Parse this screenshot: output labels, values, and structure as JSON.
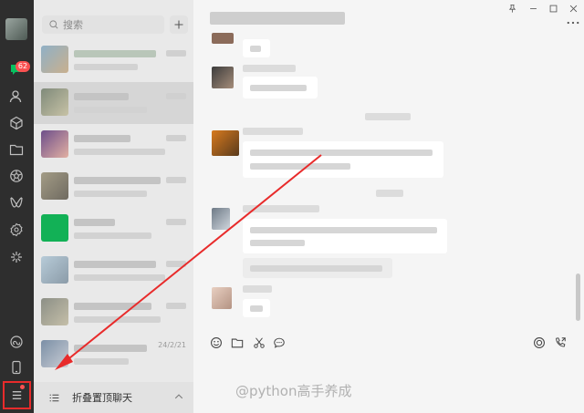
{
  "rail": {
    "unread_badge": "62",
    "icons": [
      "chat-icon",
      "contacts-icon",
      "favorites-icon",
      "files-icon",
      "moments-icon",
      "channels-icon",
      "mini-programs-icon",
      "search-discover-icon",
      "phone-icon",
      "menu-icon"
    ]
  },
  "chat_list": {
    "search_placeholder": "搜索",
    "add_label": "+",
    "row_time_label": "24/2/21",
    "fold_label": "折叠置顶聊天"
  },
  "chat": {
    "tools": [
      "emoji-icon",
      "folder-icon",
      "scissors-icon",
      "chat-bubble-icon",
      "voice-call-icon",
      "video-call-icon"
    ]
  },
  "watermark": "@python高手养成",
  "colors": {
    "rail_bg": "#2e2e2e",
    "list_bg": "#e9e9e9",
    "selected_row": "#d6d6d6",
    "chat_bg": "#f5f5f5",
    "badge": "#fa5151",
    "annotation_red": "#e82b2b"
  }
}
